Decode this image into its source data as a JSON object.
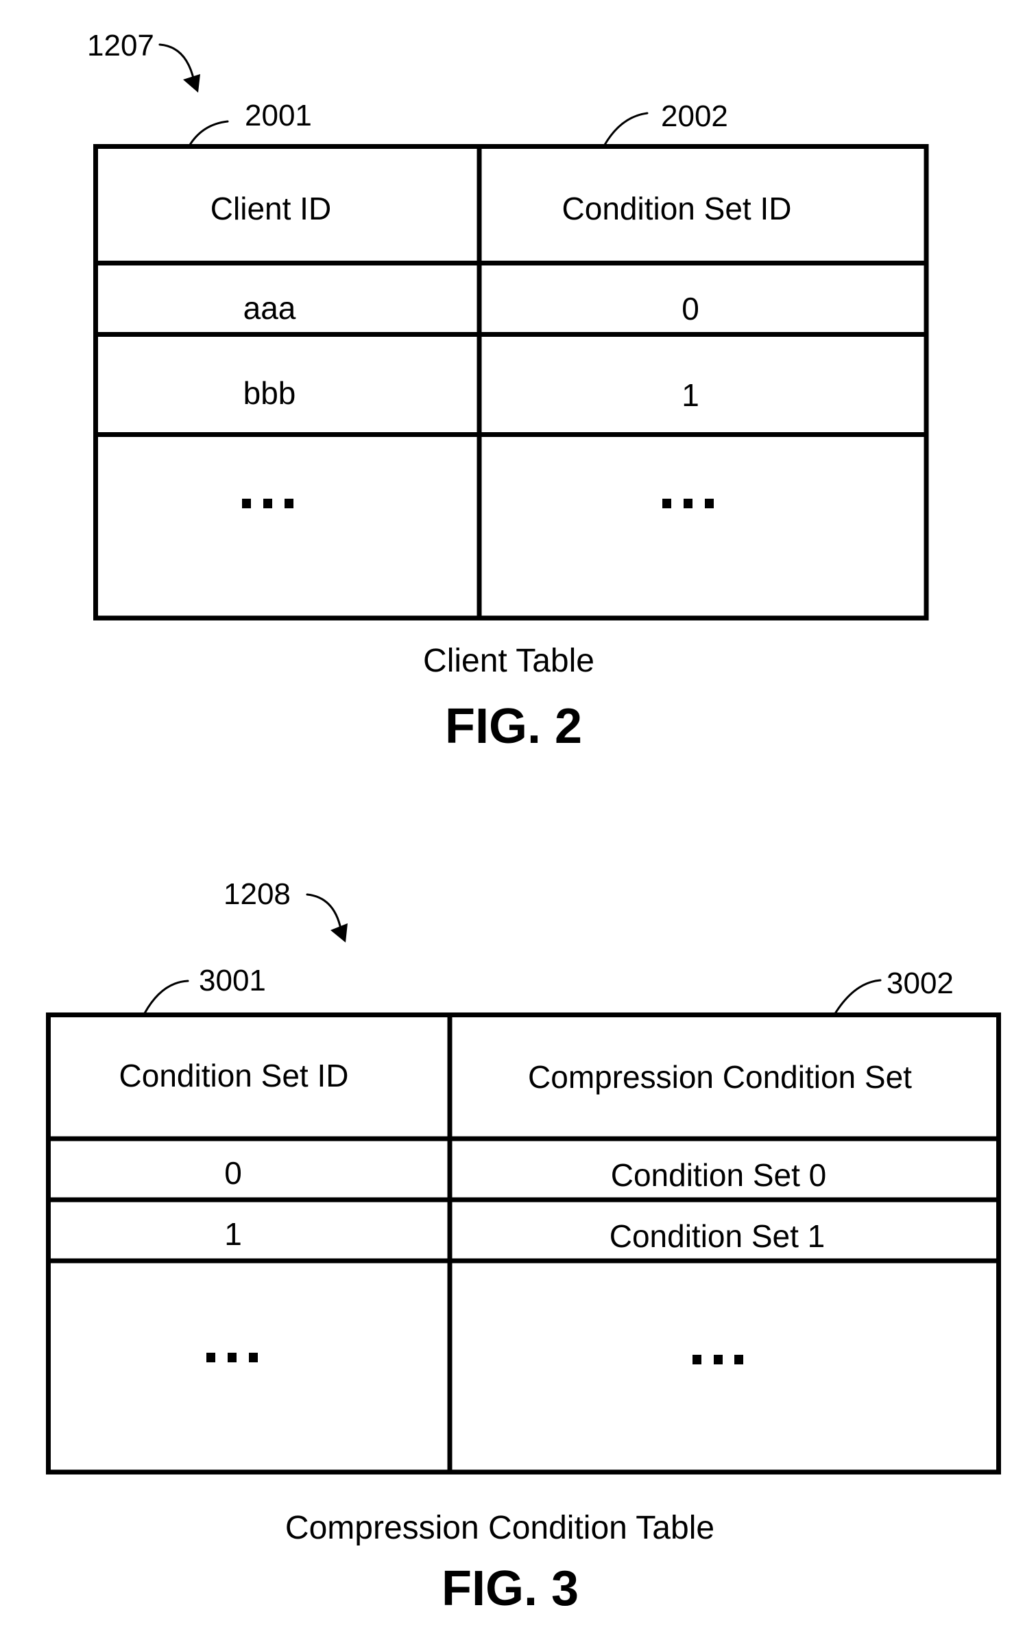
{
  "figures": [
    {
      "id": "fig2",
      "reference_number": "1207",
      "column_refs": [
        "2001",
        "2002"
      ],
      "headers": [
        "Client ID",
        "Condition Set ID"
      ],
      "rows": [
        [
          "aaa",
          "0"
        ],
        [
          "bbb",
          "1"
        ]
      ],
      "ellipsis_row": true,
      "caption": "Client Table",
      "figure_label": "FIG. 2"
    },
    {
      "id": "fig3",
      "reference_number": "1208",
      "column_refs": [
        "3001",
        "3002"
      ],
      "headers": [
        "Condition Set ID",
        "Compression Condition Set"
      ],
      "rows": [
        [
          "0",
          "Condition Set 0"
        ],
        [
          "1",
          "Condition Set 1"
        ]
      ],
      "ellipsis_row": true,
      "caption": "Compression Condition Table",
      "figure_label": "FIG. 3"
    }
  ],
  "colors": {
    "ink": "#000000",
    "paper": "#ffffff"
  }
}
